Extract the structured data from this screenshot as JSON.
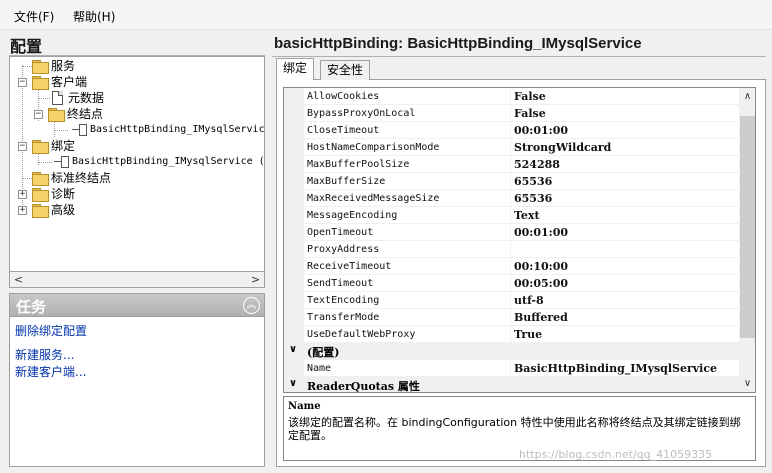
{
  "menu": {
    "file": "文件(F)",
    "help": "帮助(H)"
  },
  "left": {
    "title": "配置",
    "tree": [
      {
        "label": "服务",
        "expander": ""
      },
      {
        "label": "客户端",
        "expander": "−"
      },
      {
        "label": "元数据",
        "expander": ""
      },
      {
        "label": "终结点",
        "expander": "−"
      },
      {
        "label": "BasicHttpBinding_IMysqlServic",
        "expander": ""
      },
      {
        "label": "绑定",
        "expander": "−"
      },
      {
        "label": "BasicHttpBinding_IMysqlService (",
        "expander": ""
      },
      {
        "label": "标准终结点",
        "expander": ""
      },
      {
        "label": "诊断",
        "expander": "+"
      },
      {
        "label": "高级",
        "expander": "+"
      }
    ],
    "scroll_left": "<",
    "scroll_right": ">"
  },
  "tasks": {
    "title": "任务",
    "collapse": "︽",
    "links": [
      "删除绑定配置",
      "新建服务...",
      "新建客户端..."
    ]
  },
  "right": {
    "title": "basicHttpBinding: BasicHttpBinding_IMysqlService",
    "tabs": [
      "绑定",
      "安全性"
    ],
    "properties": [
      {
        "name": "AllowCookies",
        "value": "False"
      },
      {
        "name": "BypassProxyOnLocal",
        "value": "False"
      },
      {
        "name": "CloseTimeout",
        "value": "00:01:00"
      },
      {
        "name": "HostNameComparisonMode",
        "value": "StrongWildcard"
      },
      {
        "name": "MaxBufferPoolSize",
        "value": "524288"
      },
      {
        "name": "MaxBufferSize",
        "value": "65536"
      },
      {
        "name": "MaxReceivedMessageSize",
        "value": "65536"
      },
      {
        "name": "MessageEncoding",
        "value": "Text"
      },
      {
        "name": "OpenTimeout",
        "value": "00:01:00"
      },
      {
        "name": "ProxyAddress",
        "value": ""
      },
      {
        "name": "ReceiveTimeout",
        "value": "00:10:00"
      },
      {
        "name": "SendTimeout",
        "value": "00:05:00"
      },
      {
        "name": "TextEncoding",
        "value": "utf-8"
      },
      {
        "name": "TransferMode",
        "value": "Buffered"
      },
      {
        "name": "UseDefaultWebProxy",
        "value": "True"
      }
    ],
    "category_config": "(配置)",
    "name_prop": {
      "name": "Name",
      "value": "BasicHttpBinding_IMysqlService"
    },
    "category_quotas": "ReaderQuotas 属性",
    "chevron": "∨",
    "scroll_up": "∧",
    "scroll_down": "∨",
    "description": {
      "name": "Name",
      "text": "该绑定的配置名称。在 bindingConfiguration 特性中使用此名称将终结点及其绑定链接到绑定配置。"
    }
  },
  "watermark": "https://blog.csdn.net/qq_41059335"
}
